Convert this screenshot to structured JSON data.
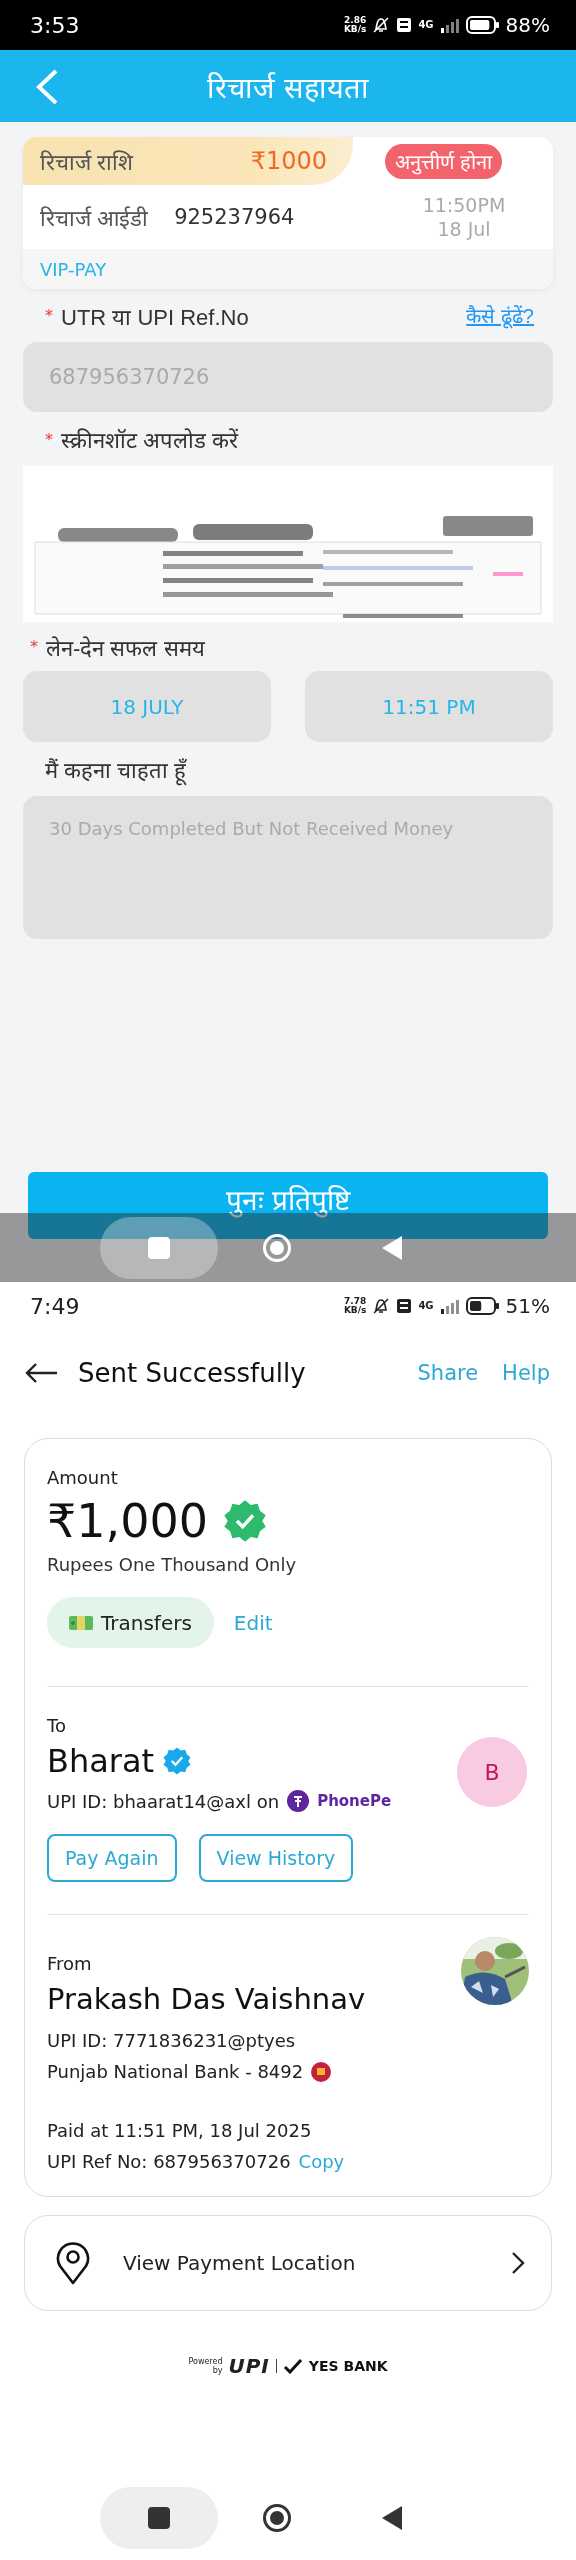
{
  "recharge_screen": {
    "status_bar": {
      "time": "3:53",
      "speed_value": "2.86",
      "speed_unit": "KB/s",
      "network": "4G",
      "battery": "88%"
    },
    "header": {
      "title": "रिचार्ज सहायता"
    },
    "recharge_card": {
      "amount_label": "रिचार्ज राशि",
      "amount": "₹1000",
      "status": "अनुत्तीर्ण होना",
      "id_label": "रिचार्ज आईडी",
      "id": "925237964",
      "time": "11:50PM",
      "date": "18 Jul",
      "channel": "VIP-PAY"
    },
    "utr": {
      "required_mark": "*",
      "label": "UTR या UPI Ref.No",
      "help_link": "कैसे ढूंढें?",
      "value": "687956370726"
    },
    "screenshot": {
      "required_mark": "*",
      "label": "स्क्रीनशॉट अपलोड करें"
    },
    "success_time": {
      "required_mark": "*",
      "label": "लेन-देन सफल समय",
      "date": "18 JULY",
      "time": "11:51 PM"
    },
    "message": {
      "label": "मैं कहना चाहता हूँ",
      "value": "30 Days Completed But Not Received Money"
    },
    "submit_button": "पुनः प्रतिपुष्टि"
  },
  "payment_screen": {
    "status_bar": {
      "time": "7:49",
      "speed_value": "7.78",
      "speed_unit": "KB/s",
      "network": "4G",
      "battery": "51%"
    },
    "header": {
      "title": "Sent Successfully",
      "actions": [
        "Share",
        "Help"
      ]
    },
    "amount": {
      "label": "Amount",
      "value": "₹1,000",
      "verified": true,
      "words": "Rupees One Thousand Only",
      "category": "Transfers",
      "edit": "Edit"
    },
    "to": {
      "label": "To",
      "name": "Bharat",
      "verified": true,
      "upi_text": "UPI ID: bhaarat14@axl on",
      "app": "PhonePe",
      "avatar_letter": "B",
      "buttons": [
        "Pay Again",
        "View History"
      ]
    },
    "from": {
      "label": "From",
      "name": "Prakash Das Vaishnav",
      "upi_id": "UPI ID: 7771836231@ptyes",
      "bank": "Punjab National Bank - 8492",
      "paid_at": "Paid at 11:51 PM, 18 Jul 2025",
      "ref": "UPI Ref No: 687956370726",
      "copy": "Copy"
    },
    "location": {
      "label": "View Payment Location"
    },
    "footer": {
      "powered": "Powered",
      "by": "by",
      "upi": "UPI",
      "bank": "YES BANK"
    }
  }
}
